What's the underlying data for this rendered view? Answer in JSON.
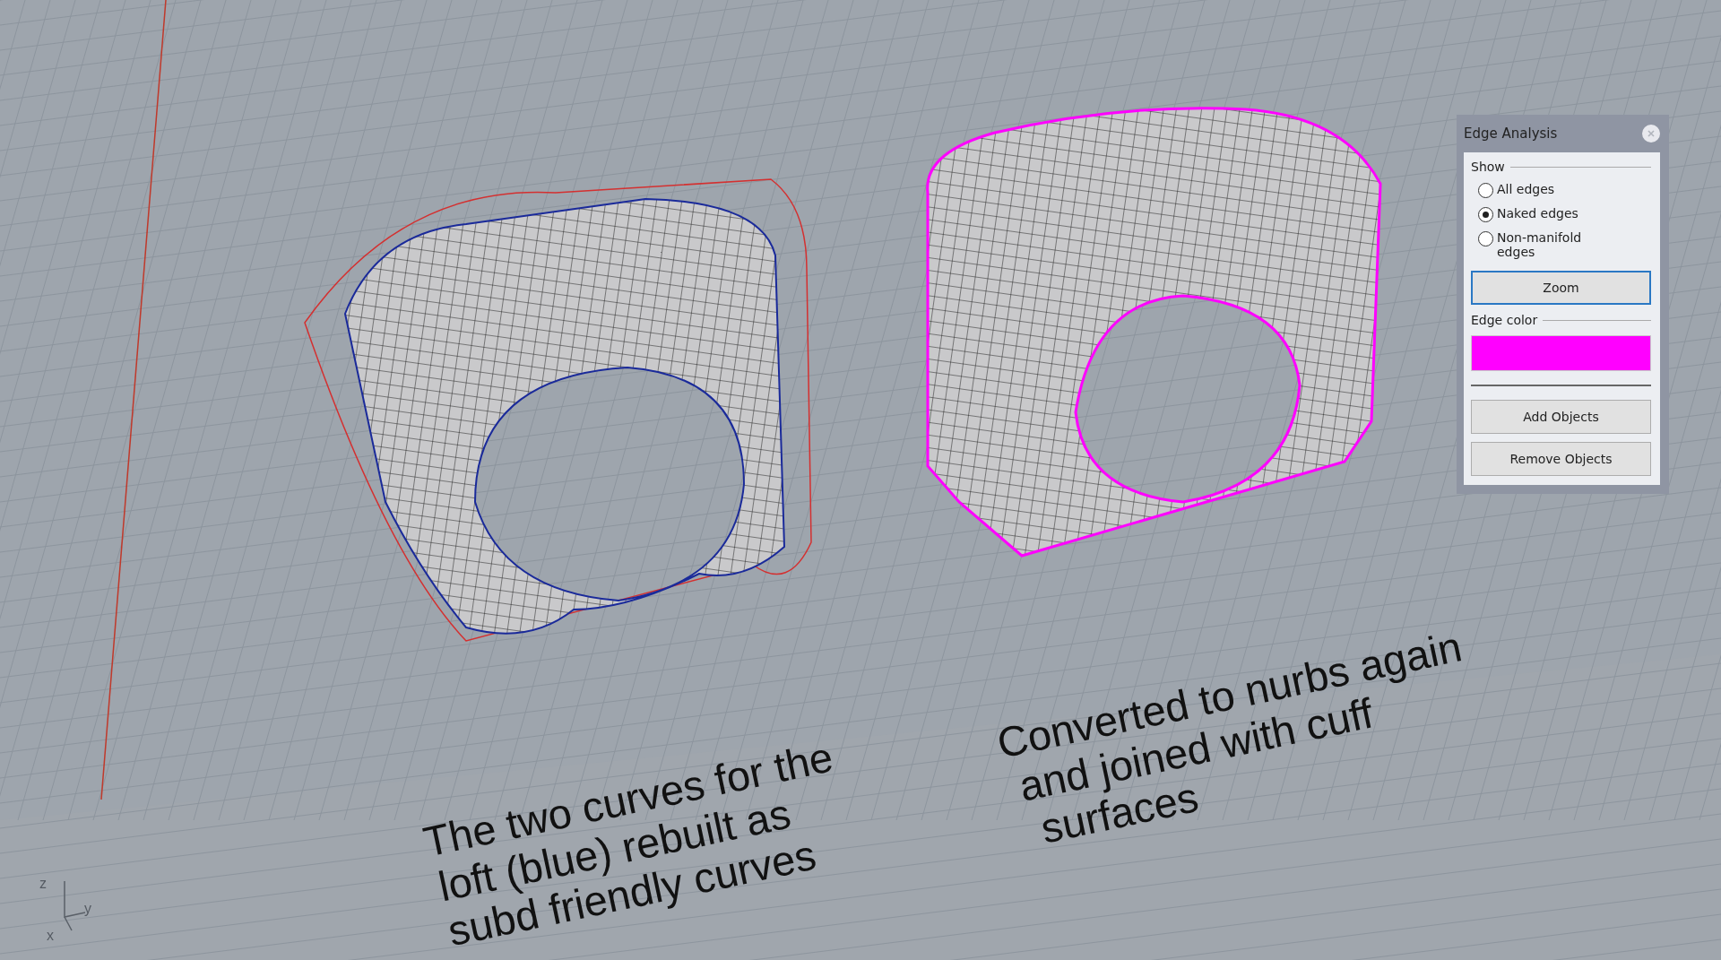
{
  "viewport": {
    "annotations": [
      {
        "lines": [
          "The two curves for the",
          "loft (blue) rebuilt as",
          "subd friendly curves"
        ]
      },
      {
        "lines": [
          "Converted to nurbs again",
          "and joined with cuff",
          "surfaces"
        ]
      }
    ],
    "axes": {
      "z": "z",
      "y": "y",
      "x": "x"
    }
  },
  "panel": {
    "title": "Edge Analysis",
    "show_label": "Show",
    "options": [
      {
        "label": "All edges",
        "selected": false
      },
      {
        "label": "Naked edges",
        "selected": true
      },
      {
        "label": "Non-manifold edges",
        "selected": false
      }
    ],
    "zoom_button": "Zoom",
    "edge_color_label": "Edge color",
    "swatch": {
      "color": "#ff00ff"
    },
    "buttons": [
      "Add Objects",
      "Remove Objects"
    ]
  }
}
